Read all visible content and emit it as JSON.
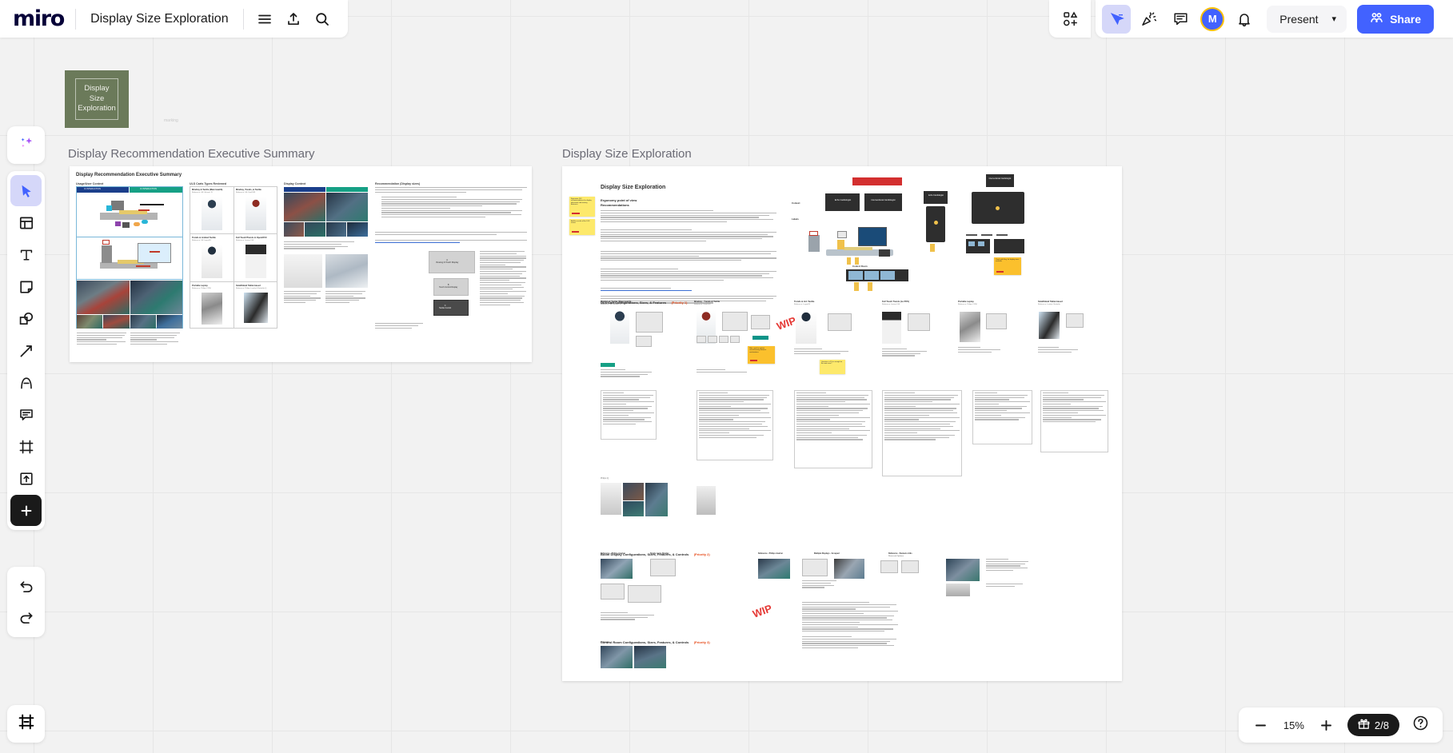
{
  "app": {
    "logo_text": "miro",
    "board_title": "Display Size Exploration"
  },
  "header": {
    "menu_icon": "hamburger-menu-icon",
    "upload_icon": "upload-icon",
    "search_icon": "search-icon",
    "templates_icon": "shapes-templates-icon",
    "cursor_icon": "cursor-select-icon",
    "celebrate_icon": "party-popper-icon",
    "comments_icon": "comment-icon",
    "avatar_initial": "M",
    "notifications_icon": "bell-icon",
    "present_label": "Present",
    "present_caret_icon": "chevron-down-icon",
    "share_label": "Share",
    "share_icon": "people-icon"
  },
  "left_toolbar": {
    "ai_icon": "ai-sparkles-icon",
    "tools": [
      {
        "name": "select-tool",
        "icon": "cursor-arrow-icon",
        "selected": true
      },
      {
        "name": "templates-tool",
        "icon": "template-grid-icon",
        "selected": false
      },
      {
        "name": "text-tool",
        "icon": "text-t-icon",
        "selected": false
      },
      {
        "name": "sticky-note-tool",
        "icon": "sticky-note-icon",
        "selected": false
      },
      {
        "name": "shapes-tool",
        "icon": "shapes-icon",
        "selected": false
      },
      {
        "name": "connector-tool",
        "icon": "arrow-connector-icon",
        "selected": false
      },
      {
        "name": "pen-tool",
        "icon": "pen-draw-icon",
        "selected": false
      },
      {
        "name": "comment-tool",
        "icon": "comment-bubble-icon",
        "selected": false
      },
      {
        "name": "frame-tool",
        "icon": "frame-icon",
        "selected": false
      },
      {
        "name": "upload-tool",
        "icon": "upload-box-icon",
        "selected": false
      },
      {
        "name": "more-apps-tool",
        "icon": "plus-icon",
        "selected": false
      }
    ],
    "undo_icon": "undo-arrow-icon",
    "redo_icon": "redo-arrow-icon",
    "frames_panel_icon": "frames-panel-icon"
  },
  "zoom_bar": {
    "minus_icon": "minus-icon",
    "zoom_level": "15%",
    "plus_icon": "plus-icon",
    "gift_icon": "gift-icon",
    "credits": "2/8",
    "help_icon": "question-mark-icon"
  },
  "canvas": {
    "title_card": {
      "text": "Display Size Exploration",
      "color": "#6b7a5a"
    },
    "tiny_marker_label": "marking",
    "frames": [
      {
        "name": "frame-executive-summary",
        "title": "Display Recommendation Executive Summary",
        "heading": "Display Recommendation Executive Summary",
        "sections": [
          {
            "label": "Usage/User Context"
          },
          {
            "label": "ULS Carts Types Reviewed"
          },
          {
            "label": "Display Context"
          },
          {
            "label": "Recommendation (Display sizes)"
          }
        ],
        "context_columns": [
          {
            "label": "IC INTERACTION",
            "color": "#1b3f8b"
          },
          {
            "label": "IC INTERACTION",
            "color": "#16a085"
          }
        ],
        "cart_types": [
          {
            "label": "Mindray & Tactile (Main Health)",
            "ref": "Reference: GE Voluson 70"
          },
          {
            "label": "Mindray, Trends, & Tactile",
            "ref": "Reference: GE Vivid E95"
          },
          {
            "label": "Trends & Limited Tactile",
            "ref": "Reference: GE Logiq E9"
          },
          {
            "label": "Full Touch/Trends in Open/OVC",
            "ref": "Reference: Innova IGS"
          },
          {
            "label": "Portable Laptop",
            "ref": "Reference: Philips CX50"
          },
          {
            "label": "Small/Hand Tablet-based",
            "ref": "Reference: Philips Lumify & Butterfly iQ"
          }
        ],
        "display_blocks": [
          {
            "label": "A\nViewing & Touch Display"
          },
          {
            "label": "B\nTouch Control Display"
          },
          {
            "label": "C\nTactile Control"
          }
        ]
      },
      {
        "name": "frame-display-size-exploration",
        "title": "Display Size Exploration",
        "heading": "Display Size Exploration",
        "subheading_1": "Ergonomy point of view",
        "subheading_2": "Recommendations",
        "role_labels": [
          "Echo Cardiologist",
          "Interventional Cardiologist",
          "Echo Cardiologist",
          "Interventional Cardiologist"
        ],
        "side_labels": [
          "Context",
          "Labels",
          "Control Room"
        ],
        "sections": [
          {
            "title": "ULS Cart Configurations, Sizes, & Features",
            "priority": "(Priority 1)"
          },
          {
            "title": "Boom Display Configurations, Sizes, Features, & Controls",
            "priority": "(Priority 2)"
          },
          {
            "title": "Control Room Configurations, Sizes, Features, & Controls",
            "priority": "(Priority 3)"
          }
        ],
        "cart_columns": [
          {
            "label": "Mindray & Tactile (Main Health)",
            "ref": "Reference: GE Voluson 70"
          },
          {
            "label": "Mindray - Trends & Tactile",
            "ref": "Reference: Vivid E95"
          },
          {
            "label": "Trends & Ltd. Tactile",
            "ref": "Reference: Logiq E9"
          },
          {
            "label": "Full Touch Trends (no POV)",
            "ref": "Reference: Innova IGS"
          },
          {
            "label": "Portable Laptop",
            "ref": "Reference: Philips CX50"
          },
          {
            "label": "Small/Hand Tablet-based",
            "ref": "Reference: Lumify / Butterfly"
          }
        ],
        "boom_columns": [
          {
            "label": "Reference - Philips Azurion",
            "ref": "Single Large Display"
          },
          {
            "label": "Reference - Philips Azurion",
            "ref": "Multiple Displays - Grouped"
          },
          {
            "label": "Reference - Siemens Artis",
            "ref": "Recessed Options"
          }
        ],
        "wip_stamps": [
          "WIP",
          "WIP"
        ],
        "stickies": [
          {
            "text": "Ergonomic ISO recommendations for display placement and viewing distances"
          },
          {
            "text": "Add the results of the ULS review"
          },
          {
            "text": "Note: need to explore control/viewing distance combinations"
          },
          {
            "text": "Check with Eng. for display sizes available"
          },
          {
            "text": "Question: is 24 in. enough for the main view?"
          }
        ]
      }
    ]
  }
}
